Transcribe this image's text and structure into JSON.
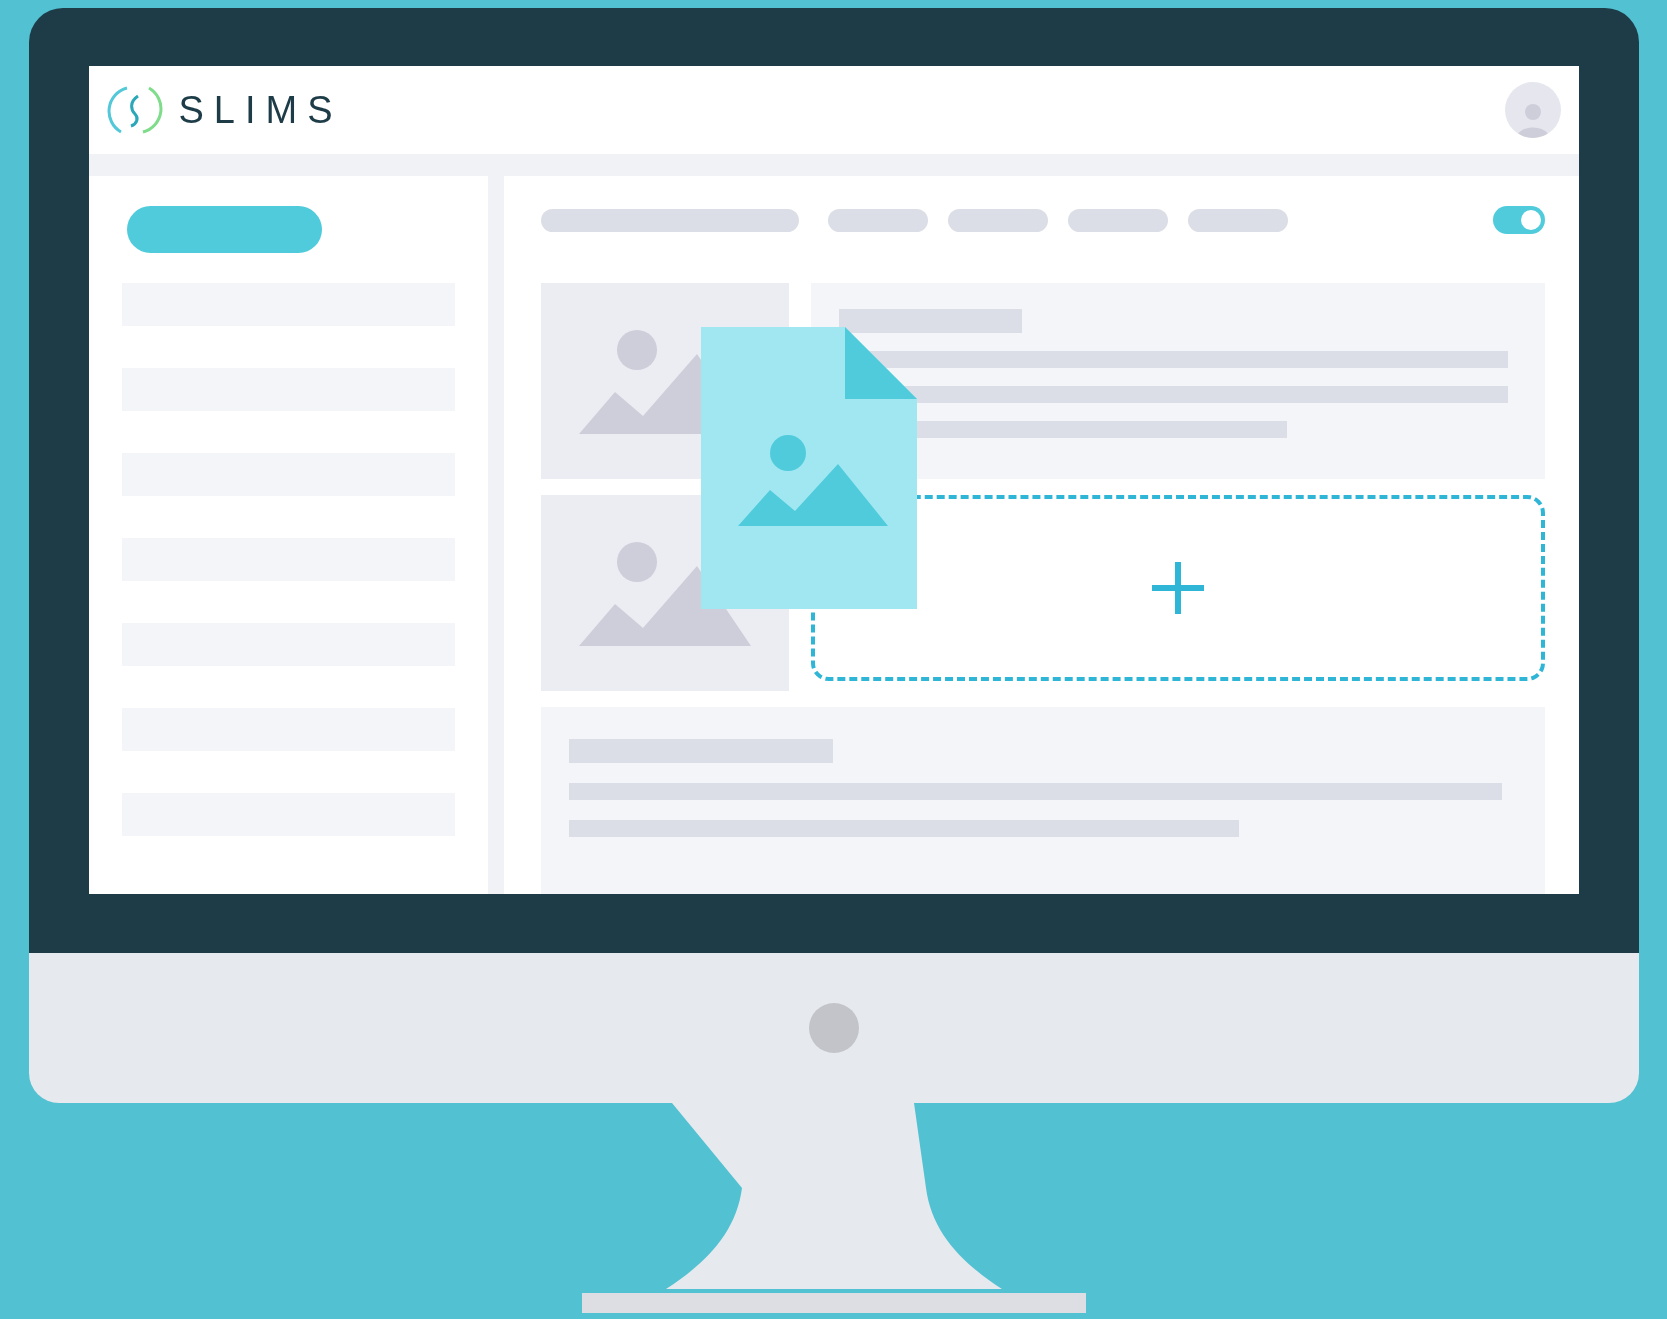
{
  "header": {
    "logo_text": "SLIMS"
  },
  "toolbar": {
    "toggle": {
      "on": true
    }
  }
}
